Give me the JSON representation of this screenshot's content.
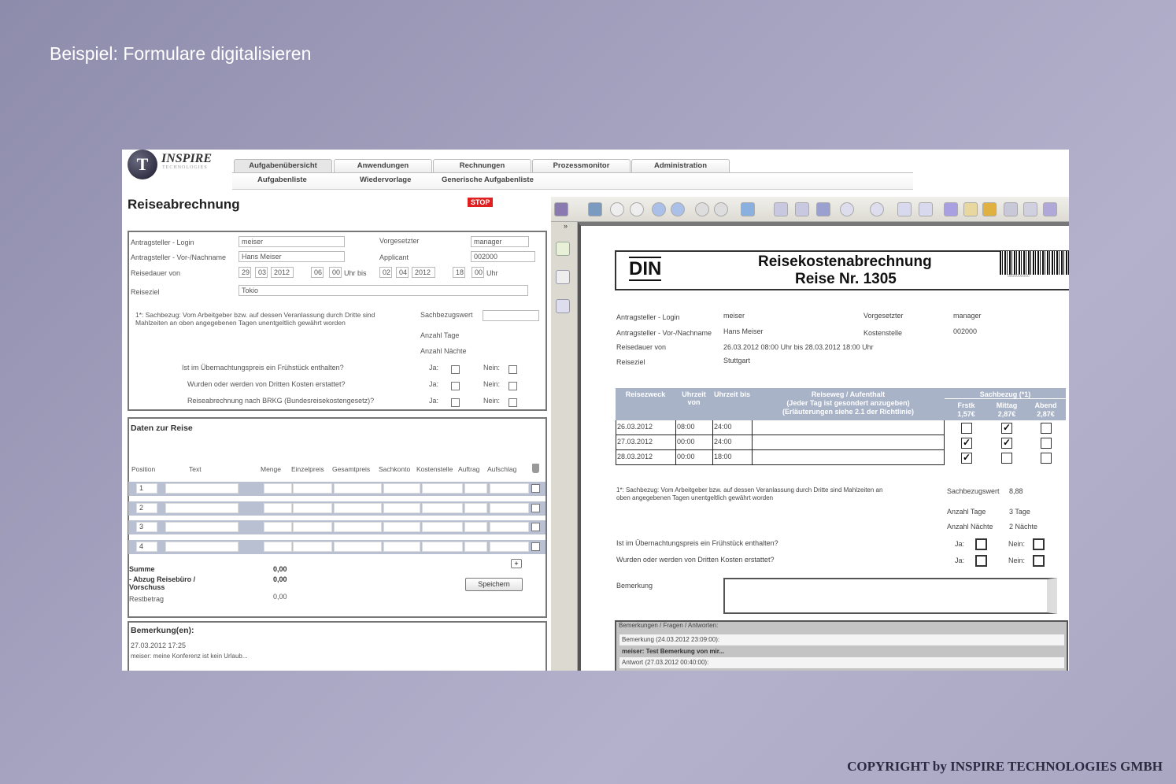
{
  "slide": {
    "title": "Beispiel: Formulare digitalisieren",
    "copyright": "COPYRIGHT by INSPIRE TECHNOLOGIES GMBH"
  },
  "logo": {
    "name": "INSPIRE",
    "sub": "TECHNOLOGIES"
  },
  "nav": {
    "tabs": [
      "Aufgabenübersicht",
      "Anwendungen",
      "Rechnungen",
      "Prozessmonitor",
      "Administration"
    ],
    "subtabs": [
      "Aufgabenliste",
      "Wiedervorlage",
      "Generische Aufgabenliste"
    ]
  },
  "form": {
    "title": "Reiseabrechnung",
    "stop": "STOP",
    "login_label": "Antragsteller - Login",
    "login": "meiser",
    "name_label": "Antragsteller - Vor-/Nachname",
    "name": "Hans Meiser",
    "duration_label": "Reisedauer von",
    "from_day": "29",
    "from_month": "03",
    "from_year": "2012",
    "from_h": "06",
    "from_m": "00",
    "uhr_bis": "Uhr bis",
    "to_day": "02",
    "to_month": "04",
    "to_year": "2012",
    "to_h": "18",
    "to_m": "00",
    "uhr": "Uhr",
    "dest_label": "Reiseziel",
    "dest": "Tokio",
    "sup_label": "Vorgesetzter",
    "sup": "manager",
    "applicant_label": "Applicant",
    "applicant": "002000",
    "note": "1*: Sachbezug: Vom Arbeitgeber bzw. auf dessen Veranlassung durch Dritte sind Mahlzeiten an oben angegebenen Tagen unentgeltlich gewährt worden",
    "sachbezug_label": "Sachbezugswert",
    "tage_label": "Anzahl Tage",
    "naechte_label": "Anzahl Nächte",
    "questions": [
      "Ist im Übernachtungspreis ein Frühstück enthalten?",
      "Wurden oder werden von Dritten Kosten erstattet?",
      "Reiseabrechnung nach BRKG (Bundesreisekostengesetz)?"
    ],
    "ja": "Ja:",
    "nein": "Nein:"
  },
  "trip": {
    "title": "Daten zur Reise",
    "columns": [
      "Position",
      "Text",
      "Menge",
      "Einzelpreis",
      "Gesamtpreis",
      "Sachkonto",
      "Kostenstelle",
      "Auftrag",
      "Aufschlag"
    ],
    "rows": [
      "1",
      "2",
      "3",
      "4"
    ],
    "summe_label": "Summe",
    "summe": "0,00",
    "abzug_label": "- Abzug Reisebüro / Vorschuss",
    "abzug": "0,00",
    "rest_label": "Restbetrag",
    "rest": "0,00",
    "add": "+",
    "save": "Speichern"
  },
  "remarks": {
    "title": "Bemerkung(en):",
    "date": "27.03.2012 17:25",
    "text": "meiser: meine Konferenz ist kein Urlaub..."
  },
  "doc": {
    "din": "DIN",
    "title": "Reisekostenabrechnung",
    "subtitle": "Reise Nr. 1305",
    "barcode": "0000000000",
    "login_label": "Antragsteller - Login",
    "login": "meiser",
    "name_label": "Antragsteller - Vor-/Nachname",
    "name": "Hans Meiser",
    "duration_label": "Reisedauer von",
    "duration": "26.03.2012 08:00 Uhr bis 28.03.2012 18:00 Uhr",
    "dest_label": "Reiseziel",
    "dest": "Stuttgart",
    "sup_label": "Vorgesetzter",
    "sup": "manager",
    "cost_label": "Kostenstelle",
    "cost": "002000",
    "th": {
      "zweck": "Reisezweck",
      "von": "Uhrzeit von",
      "bis": "Uhrzeit bis",
      "weg": "Reiseweg / Aufenthalt",
      "weg2": "(Jeder Tag ist gesondert anzugeben)",
      "weg3": "(Erläuterungen siehe 2.1 der Richtlinie)",
      "sach": "Sachbezug (*1)",
      "fr": "Frstk",
      "fr_p": "1,57€",
      "mi": "Mittag",
      "mi_p": "2,87€",
      "ab": "Abend",
      "ab_p": "2,87€"
    },
    "rows": [
      {
        "date": "26.03.2012",
        "von": "08:00",
        "bis": "24:00",
        "fr": false,
        "mi": true,
        "ab": false
      },
      {
        "date": "27.03.2012",
        "von": "00:00",
        "bis": "24:00",
        "fr": true,
        "mi": true,
        "ab": false
      },
      {
        "date": "28.03.2012",
        "von": "00:00",
        "bis": "18:00",
        "fr": true,
        "mi": false,
        "ab": false
      }
    ],
    "note": "1*: Sachbezug: Vom Arbeitgeber bzw. auf dessen Veranlassung durch Dritte sind Mahlzeiten an",
    "note2": "oben angegebenen Tagen unentgeltlich gewährt worden",
    "sachbezug_label": "Sachbezugswert",
    "sachbezug": "8,88",
    "tage_label": "Anzahl Tage",
    "tage": "3 Tage",
    "naechte_label": "Anzahl Nächte",
    "naechte": "2 Nächte",
    "q1": "Ist im Übernachtungspreis ein Frühstück enthalten?",
    "q2": "Wurden oder werden von Dritten Kosten erstattet?",
    "ja": "Ja:",
    "nein": "Nein:",
    "bem_label": "Bemerkung",
    "comments": {
      "header": "Bemerkungen / Fragen / Antworten:",
      "c1": "Bemerkung (24.03.2012 23:09:00):",
      "c2": "meiser: Test Bemerkung von mir...",
      "c3": "Antwort (27.03.2012 00:40:00):"
    }
  }
}
